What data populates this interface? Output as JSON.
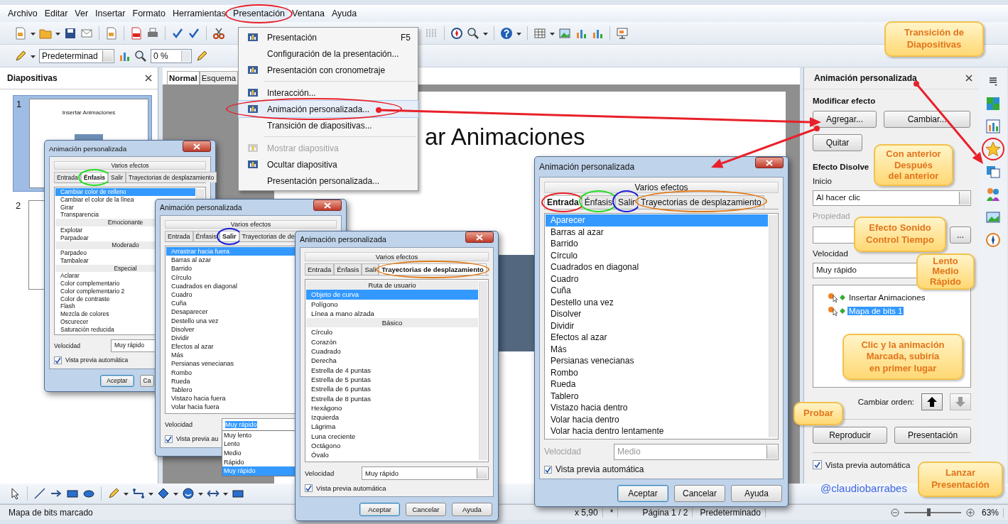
{
  "menubar": [
    {
      "label": "Archivo",
      "selected": false,
      "circled": false
    },
    {
      "label": "Editar",
      "selected": false,
      "circled": false
    },
    {
      "label": "Ver",
      "selected": false,
      "circled": false
    },
    {
      "label": "Insertar",
      "selected": false,
      "circled": false
    },
    {
      "label": "Formato",
      "selected": false,
      "circled": false
    },
    {
      "label": "Herramientas",
      "selected": false,
      "circled": false
    },
    {
      "label": "Presentación",
      "selected": true,
      "circled": true
    },
    {
      "label": "Ventana",
      "selected": false,
      "circled": false
    },
    {
      "label": "Ayuda",
      "selected": false,
      "circled": false
    }
  ],
  "toolbar": {
    "style": "Predeterminad",
    "transparency": "0 %"
  },
  "slides_panel": {
    "title": "Diapositivas",
    "slides": [
      {
        "number": "1",
        "title": "Insertar Animaciones",
        "selected": true
      },
      {
        "number": "2",
        "selected": false
      }
    ]
  },
  "view_tabs": [
    {
      "label": "Normal",
      "selected": true
    },
    {
      "label": "Esquema",
      "selected": false
    }
  ],
  "slide": {
    "title": "ar Animaciones"
  },
  "menu": {
    "items": [
      {
        "kind": "item",
        "label": "Presentación",
        "shortcut": "F5",
        "has_icon": true,
        "disabled": false,
        "highlighted": false,
        "circled": false
      },
      {
        "kind": "item",
        "label": "Configuración de la presentación...",
        "has_icon": false,
        "disabled": false,
        "highlighted": false,
        "circled": false
      },
      {
        "kind": "item",
        "label": "Presentación con cronometraje",
        "has_icon": true,
        "disabled": false,
        "highlighted": false,
        "circled": false
      },
      {
        "kind": "separator"
      },
      {
        "kind": "item",
        "label": "Interacción...",
        "has_icon": true,
        "disabled": false,
        "highlighted": false,
        "circled": false
      },
      {
        "kind": "item",
        "label": "Animación personalizada...",
        "has_icon": true,
        "disabled": false,
        "highlighted": true,
        "circled": true
      },
      {
        "kind": "item",
        "label": "Transición de diapositivas...",
        "has_icon": false,
        "disabled": false,
        "highlighted": false,
        "circled": false
      },
      {
        "kind": "separator"
      },
      {
        "kind": "item",
        "label": "Mostrar diapositiva",
        "has_icon": true,
        "disabled": true,
        "highlighted": false,
        "circled": false
      },
      {
        "kind": "item",
        "label": "Ocultar diapositiva",
        "has_icon": true,
        "disabled": false,
        "highlighted": false,
        "circled": false
      },
      {
        "kind": "item",
        "label": "Presentación personalizada...",
        "has_icon": false,
        "disabled": false,
        "highlighted": false,
        "circled": false
      }
    ]
  },
  "dialogs": [
    {
      "title": "Animación personalizada",
      "group": "Varios efectos",
      "tabs": [
        {
          "label": "Entrada",
          "selected": false
        },
        {
          "label": "Énfasis",
          "selected": true,
          "color": "#22dd22"
        },
        {
          "label": "Salir",
          "selected": false
        },
        {
          "label": "Trayectorias de desplazamiento",
          "selected": false
        }
      ],
      "items": [
        {
          "kind": "item",
          "label": "Cambiar color de relleno",
          "selected": true
        },
        {
          "kind": "item",
          "label": "Cambiar el color de la línea",
          "selected": false
        },
        {
          "kind": "item",
          "label": "Girar",
          "selected": false
        },
        {
          "kind": "item",
          "label": "Transparencia",
          "selected": false
        },
        {
          "kind": "header",
          "label": "Emocionante"
        },
        {
          "kind": "item",
          "label": "Explotar",
          "selected": false
        },
        {
          "kind": "item",
          "label": "Parpadear",
          "selected": false
        },
        {
          "kind": "header",
          "label": "Moderado"
        },
        {
          "kind": "item",
          "label": "Parpadeo",
          "selected": false
        },
        {
          "kind": "item",
          "label": "Tambalear",
          "selected": false
        },
        {
          "kind": "header",
          "label": "Especial"
        },
        {
          "kind": "item",
          "label": "Aclarar",
          "selected": false
        },
        {
          "kind": "item",
          "label": "Color complementario",
          "selected": false
        },
        {
          "kind": "item",
          "label": "Color complementario 2",
          "selected": false
        },
        {
          "kind": "item",
          "label": "Color de contraste",
          "selected": false
        },
        {
          "kind": "item",
          "label": "Flash",
          "selected": false
        },
        {
          "kind": "item",
          "label": "Mezcla de colores",
          "selected": false
        },
        {
          "kind": "item",
          "label": "Oscurecer",
          "selected": false
        },
        {
          "kind": "item",
          "label": "Saturación reducida",
          "selected": false
        }
      ],
      "speed_label": "Velocidad",
      "speed": "Muy rápido",
      "speed_disabled": false,
      "preview": {
        "label": "Vista previa automática",
        "checked": true
      },
      "buttons": [
        "Aceptar",
        "Ca"
      ]
    },
    {
      "title": "Animación personalizada",
      "group": "Varios efectos",
      "tabs": [
        {
          "label": "Entrada",
          "selected": false
        },
        {
          "label": "Énfasis",
          "selected": false
        },
        {
          "label": "Salir",
          "selected": true,
          "color": "#1a1ad8"
        },
        {
          "label": "Trayectorias de de",
          "selected": false
        }
      ],
      "items": [
        {
          "kind": "item",
          "label": "Arrastrar hacia fuera",
          "selected": true
        },
        {
          "kind": "item",
          "label": "Barras al azar",
          "selected": false
        },
        {
          "kind": "item",
          "label": "Barrido",
          "selected": false
        },
        {
          "kind": "item",
          "label": "Círculo",
          "selected": false
        },
        {
          "kind": "item",
          "label": "Cuadrados en diagonal",
          "selected": false
        },
        {
          "kind": "item",
          "label": "Cuadro",
          "selected": false
        },
        {
          "kind": "item",
          "label": "Cuña",
          "selected": false
        },
        {
          "kind": "item",
          "label": "Desaparecer",
          "selected": false
        },
        {
          "kind": "item",
          "label": "Destello una vez",
          "selected": false
        },
        {
          "kind": "item",
          "label": "Disolver",
          "selected": false
        },
        {
          "kind": "item",
          "label": "Dividir",
          "selected": false
        },
        {
          "kind": "item",
          "label": "Efectos al azar",
          "selected": false
        },
        {
          "kind": "item",
          "label": "Más",
          "selected": false
        },
        {
          "kind": "item",
          "label": "Persianas venecianas",
          "selected": false
        },
        {
          "kind": "item",
          "label": "Rombo",
          "selected": false
        },
        {
          "kind": "item",
          "label": "Rueda",
          "selected": false
        },
        {
          "kind": "item",
          "label": "Tablero",
          "selected": false
        },
        {
          "kind": "item",
          "label": "Vistazo hacia fuera",
          "selected": false
        },
        {
          "kind": "item",
          "label": "Volar hacia fuera",
          "selected": false
        }
      ],
      "speed_label": "Velocidad",
      "speed": "Muy rápido",
      "speed_disabled": false,
      "speed_options": [
        {
          "label": "Muy lento",
          "selected": false
        },
        {
          "label": "Lento",
          "selected": false
        },
        {
          "label": "Medio",
          "selected": false
        },
        {
          "label": "Rápido",
          "selected": false
        },
        {
          "label": "Muy rápido",
          "selected": true
        }
      ],
      "preview": {
        "label": "Vista previa au",
        "checked": true
      }
    },
    {
      "title": "Animación personalizada",
      "group": "Varios efectos",
      "tabs": [
        {
          "label": "Entrada",
          "selected": false
        },
        {
          "label": "Énfasis",
          "selected": false
        },
        {
          "label": "Sali",
          "selected": false
        },
        {
          "label": "Trayectorias de desplazamiento",
          "selected": true,
          "color": "#e07a1a"
        }
      ],
      "items": [
        {
          "kind": "header",
          "label": "Ruta de usuario"
        },
        {
          "kind": "item",
          "label": "Objeto de curva",
          "selected": true
        },
        {
          "kind": "item",
          "label": "Polígono",
          "selected": false
        },
        {
          "kind": "item",
          "label": "Línea a mano alzada",
          "selected": false
        },
        {
          "kind": "header",
          "label": "Básico"
        },
        {
          "kind": "item",
          "label": "Círculo",
          "selected": false
        },
        {
          "kind": "item",
          "label": "Corazón",
          "selected": false
        },
        {
          "kind": "item",
          "label": "Cuadrado",
          "selected": false
        },
        {
          "kind": "item",
          "label": "Derecha",
          "selected": false
        },
        {
          "kind": "item",
          "label": "Estrella de 4 puntas",
          "selected": false
        },
        {
          "kind": "item",
          "label": "Estrella de 5 puntas",
          "selected": false
        },
        {
          "kind": "item",
          "label": "Estrella de 6 puntas",
          "selected": false
        },
        {
          "kind": "item",
          "label": "Estrella de 8 puntas",
          "selected": false
        },
        {
          "kind": "item",
          "label": "Hexágono",
          "selected": false
        },
        {
          "kind": "item",
          "label": "Izquierda",
          "selected": false
        },
        {
          "kind": "item",
          "label": "Lágrima",
          "selected": false
        },
        {
          "kind": "item",
          "label": "Luna creciente",
          "selected": false
        },
        {
          "kind": "item",
          "label": "Octágono",
          "selected": false
        },
        {
          "kind": "item",
          "label": "Óvalo",
          "selected": false
        }
      ],
      "speed_label": "Velocidad",
      "speed": "Muy rápido",
      "speed_disabled": false,
      "preview": {
        "label": "Vista previa automática",
        "checked": true
      },
      "buttons": [
        "Aceptar",
        "Cancelar",
        "Ayuda"
      ]
    },
    {
      "title": "Animación personalizada",
      "group": "Varios efectos",
      "tabs": [
        {
          "label": "Entrada",
          "selected": true,
          "color": "#e8202a"
        },
        {
          "label": "Énfasis",
          "selected": false,
          "color": "#22dd22"
        },
        {
          "label": "Salir",
          "selected": false,
          "color": "#1a1ad8"
        },
        {
          "label": "Trayectorias de desplazamiento",
          "selected": false,
          "color": "#e07a1a"
        }
      ],
      "items": [
        {
          "kind": "item",
          "label": "Aparecer",
          "selected": true
        },
        {
          "kind": "item",
          "label": "Barras al azar",
          "selected": false
        },
        {
          "kind": "item",
          "label": "Barrido",
          "selected": false
        },
        {
          "kind": "item",
          "label": "Círculo",
          "selected": false
        },
        {
          "kind": "item",
          "label": "Cuadrados en diagonal",
          "selected": false
        },
        {
          "kind": "item",
          "label": "Cuadro",
          "selected": false
        },
        {
          "kind": "item",
          "label": "Cuña",
          "selected": false
        },
        {
          "kind": "item",
          "label": "Destello una vez",
          "selected": false
        },
        {
          "kind": "item",
          "label": "Disolver",
          "selected": false
        },
        {
          "kind": "item",
          "label": "Dividir",
          "selected": false
        },
        {
          "kind": "item",
          "label": "Efectos al azar",
          "selected": false
        },
        {
          "kind": "item",
          "label": "Más",
          "selected": false
        },
        {
          "kind": "item",
          "label": "Persianas venecianas",
          "selected": false
        },
        {
          "kind": "item",
          "label": "Rombo",
          "selected": false
        },
        {
          "kind": "item",
          "label": "Rueda",
          "selected": false
        },
        {
          "kind": "item",
          "label": "Tablero",
          "selected": false
        },
        {
          "kind": "item",
          "label": "Vistazo hacia dentro",
          "selected": false
        },
        {
          "kind": "item",
          "label": "Volar hacia dentro",
          "selected": false
        },
        {
          "kind": "item",
          "label": "Volar hacia dentro lentamente",
          "selected": false
        }
      ],
      "speed_label": "Velocidad",
      "speed": "Medio",
      "speed_disabled": true,
      "preview": {
        "label": "Vista previa automática",
        "checked": true
      },
      "buttons": [
        "Aceptar",
        "Cancelar",
        "Ayuda"
      ]
    }
  ],
  "task_panel": {
    "title": "Animación personalizada",
    "section": "Modificar efecto",
    "add": "Agregar...",
    "change": "Cambiar...",
    "remove": "Quitar",
    "effect": "Efecto Disolve",
    "start_label": "Inicio",
    "start": "Al hacer clic",
    "property": {
      "label": "Propiedad",
      "disabled": true
    },
    "more": "...",
    "speed_label": "Velocidad",
    "speed": "Muy rápido",
    "animations": [
      {
        "label": "Insertar Animaciones",
        "selected": false
      },
      {
        "label": "Mapa de bits 1",
        "selected": true
      }
    ],
    "order_label": "Cambiar orden:",
    "up_disabled": false,
    "down_disabled": true,
    "play": "Reproducir",
    "show": "Presentación",
    "preview": {
      "label": "Vista previa automática",
      "checked": true
    }
  },
  "sidebar": [
    {
      "kind": "menu",
      "circled": false
    },
    {
      "kind": "cube",
      "circled": false
    },
    {
      "kind": "chart",
      "circled": false
    },
    {
      "kind": "star",
      "circled": true
    },
    {
      "kind": "transition",
      "circled": false
    },
    {
      "kind": "people",
      "circled": false
    },
    {
      "kind": "picture",
      "circled": false
    },
    {
      "kind": "compass",
      "circled": false
    }
  ],
  "callouts": [
    "Transición de\nDiapositivas",
    "Con anterior\nDespués\ndel anterior",
    "Efecto Sonido\nControl Tiempo",
    "Lento\nMedio\nRápido",
    "Clic y la animación\nMarcada, subiría\nen primer lugar",
    "Probar",
    "Lanzar\nPresentación"
  ],
  "credit": "@claudiobarrabes",
  "status_bar": {
    "fields": [
      "Mapa de bits marcado",
      "x 5,90",
      "*",
      "Página 1 / 2",
      "Predeterminado"
    ],
    "zoom": {
      "label": "63%",
      "level": 0.42
    }
  }
}
